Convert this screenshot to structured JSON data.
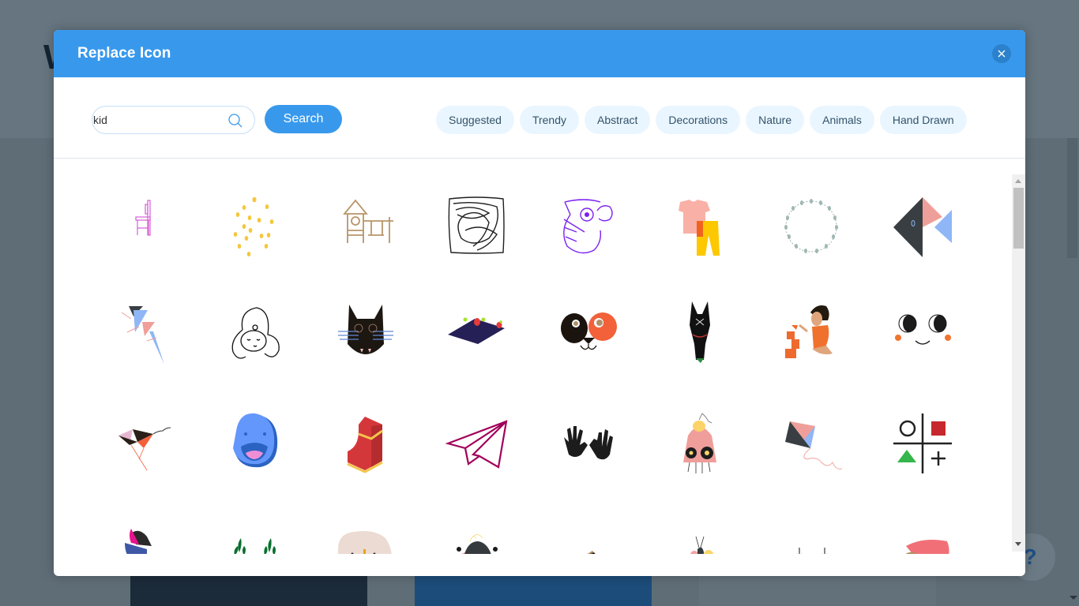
{
  "background": {
    "help_label": "?"
  },
  "modal": {
    "title": "Replace Icon",
    "close_label": "close"
  },
  "search": {
    "value": "kid",
    "placeholder": "",
    "button_label": "Search"
  },
  "categories": [
    {
      "label": "Suggested"
    },
    {
      "label": "Trendy"
    },
    {
      "label": "Abstract"
    },
    {
      "label": "Decorations"
    },
    {
      "label": "Nature"
    },
    {
      "label": "Animals"
    },
    {
      "label": "Hand Drawn"
    }
  ],
  "colors": {
    "accent": "#3899ec",
    "chip_bg": "#eaf6ff",
    "overlay": "#65737d"
  },
  "icons": [
    {
      "name": "chair-icon"
    },
    {
      "name": "yellow-dots-icon"
    },
    {
      "name": "playground-icon"
    },
    {
      "name": "scribble-icon"
    },
    {
      "name": "parrot-icon"
    },
    {
      "name": "kids-clothes-icon"
    },
    {
      "name": "leaf-wreath-icon"
    },
    {
      "name": "geometric-fish-icon"
    },
    {
      "name": "geometric-kite-icon"
    },
    {
      "name": "girl-face-icon"
    },
    {
      "name": "black-cat-icon"
    },
    {
      "name": "party-table-icon"
    },
    {
      "name": "puppy-face-icon"
    },
    {
      "name": "dog-head-icon"
    },
    {
      "name": "child-blocks-icon"
    },
    {
      "name": "cute-face-icon"
    },
    {
      "name": "kite-icon"
    },
    {
      "name": "blue-smiley-icon"
    },
    {
      "name": "toy-brick-icon"
    },
    {
      "name": "paper-plane-icon"
    },
    {
      "name": "hand-prints-icon"
    },
    {
      "name": "pink-monster-icon"
    },
    {
      "name": "diamond-kite-icon"
    },
    {
      "name": "tic-tac-toe-icon"
    },
    {
      "name": "girl-hat-icon"
    },
    {
      "name": "green-sprigs-icon"
    },
    {
      "name": "beige-face-icon"
    },
    {
      "name": "dark-head-icon"
    },
    {
      "name": "brown-shape-icon"
    },
    {
      "name": "bee-icon"
    },
    {
      "name": "small-sprigs-icon"
    },
    {
      "name": "pink-fan-icon"
    }
  ]
}
